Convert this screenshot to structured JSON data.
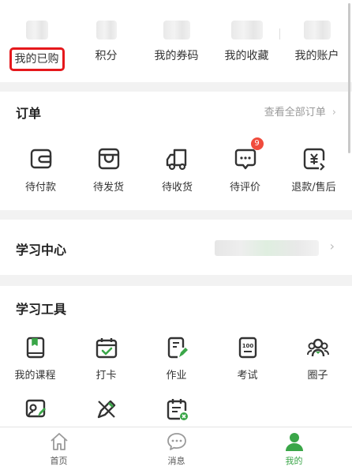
{
  "stats": [
    {
      "label": "我的已购",
      "highlighted": true
    },
    {
      "label": "积分",
      "highlighted": false
    },
    {
      "label": "我的券码",
      "highlighted": false
    },
    {
      "label": "我的收藏",
      "highlighted": false
    },
    {
      "label": "我的账户",
      "highlighted": false
    }
  ],
  "orders": {
    "title": "订单",
    "more_label": "查看全部订单",
    "items": [
      {
        "label": "待付款",
        "icon": "wallet-icon"
      },
      {
        "label": "待发货",
        "icon": "box-icon"
      },
      {
        "label": "待收货",
        "icon": "truck-icon"
      },
      {
        "label": "待评价",
        "icon": "comment-icon",
        "badge": "9"
      },
      {
        "label": "退款/售后",
        "icon": "refund-icon"
      }
    ]
  },
  "learning_center": {
    "title": "学习中心"
  },
  "tools": {
    "title": "学习工具",
    "items": [
      {
        "label": "我的课程",
        "icon": "book-icon"
      },
      {
        "label": "打卡",
        "icon": "calendar-check-icon"
      },
      {
        "label": "作业",
        "icon": "homework-icon"
      },
      {
        "label": "考试",
        "icon": "exam-icon"
      },
      {
        "label": "圈子",
        "icon": "group-icon"
      },
      {
        "label": "",
        "icon": "user-edit-icon"
      },
      {
        "label": "",
        "icon": "pencil-ruler-icon"
      },
      {
        "label": "",
        "icon": "calendar-cancel-icon"
      }
    ]
  },
  "tabbar": {
    "tabs": [
      {
        "label": "首页",
        "icon": "home-icon",
        "active": false
      },
      {
        "label": "消息",
        "icon": "message-icon",
        "active": false
      },
      {
        "label": "我的",
        "icon": "profile-icon",
        "active": true
      }
    ]
  },
  "colors": {
    "accent": "#3aa648",
    "highlight": "#e5181c",
    "badge": "#f04b3c",
    "icon": "#333333"
  }
}
